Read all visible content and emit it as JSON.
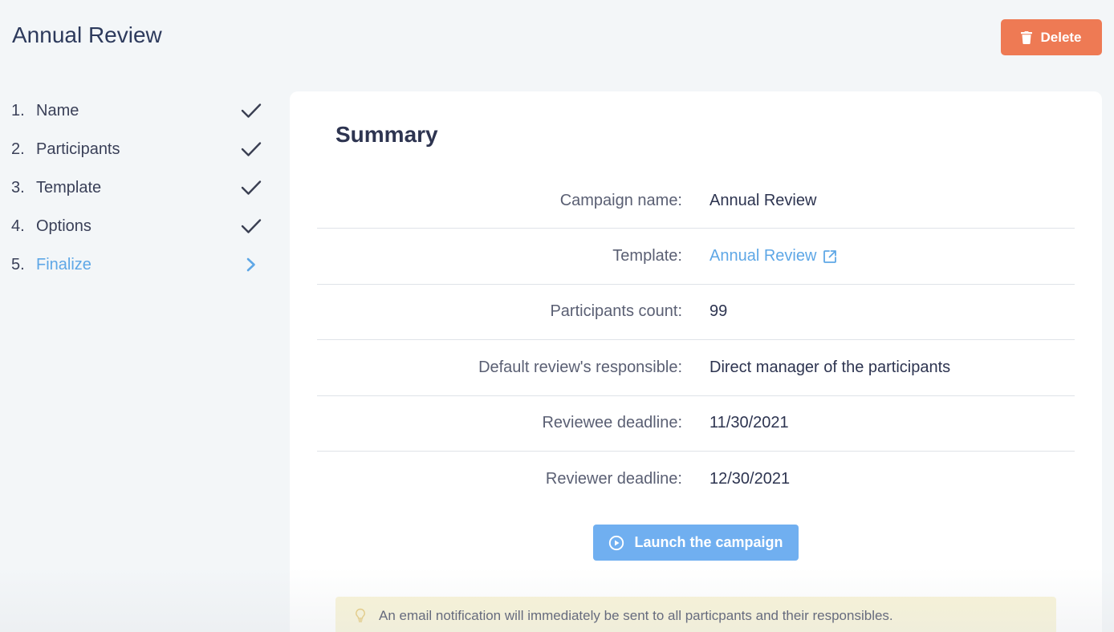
{
  "header": {
    "title": "Annual Review",
    "delete_label": "Delete",
    "delete_color": "#ee7a54"
  },
  "steps": [
    {
      "number": "1.",
      "label": "Name",
      "icon": "check-icon",
      "state": "done"
    },
    {
      "number": "2.",
      "label": "Participants",
      "icon": "check-icon",
      "state": "done"
    },
    {
      "number": "3.",
      "label": "Template",
      "icon": "check-icon",
      "state": "done"
    },
    {
      "number": "4.",
      "label": "Options",
      "icon": "check-icon",
      "state": "done"
    },
    {
      "number": "5.",
      "label": "Finalize",
      "icon": "chevron-right-icon",
      "state": "active"
    }
  ],
  "summary": {
    "title": "Summary",
    "rows": [
      {
        "label": "Campaign name:",
        "value": "Annual Review"
      },
      {
        "label": "Template:",
        "value": "Annual Review",
        "icon": "external-link-icon"
      },
      {
        "label": "Participants count:",
        "value": "99"
      },
      {
        "label": "Default review's responsible:",
        "value": "Direct manager of the participants"
      },
      {
        "label": "Reviewee deadline:",
        "value": "11/30/2021"
      },
      {
        "label": "Reviewer deadline:",
        "value": "12/30/2021"
      }
    ],
    "launch_label": "Launch the campaign",
    "launch_icon": "play-circle-icon",
    "notice_icon": "lightbulb-icon",
    "notice_text": "An email notification will immediately be sent to all particpants and their responsibles."
  },
  "colors": {
    "accent": "#5ea7e6",
    "launch": "#70aff0",
    "notice_bg": "#f8f3d4"
  }
}
